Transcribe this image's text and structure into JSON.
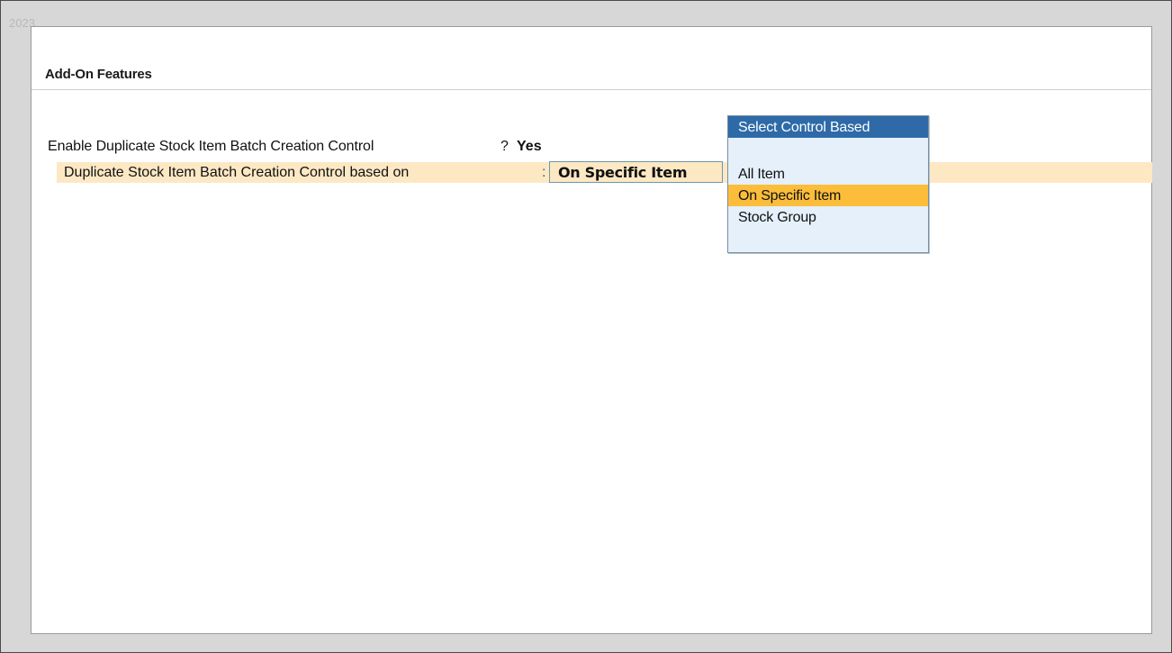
{
  "corner_text": "2023",
  "panel": {
    "title": "Add-On Features"
  },
  "fields": {
    "enable_duplicate": {
      "label": "Enable Duplicate Stock Item Batch Creation Control",
      "separator": "?",
      "value": "Yes"
    },
    "control_based_on": {
      "label": "Duplicate Stock Item Batch Creation Control based on",
      "separator": ":",
      "value": "On Specific Item"
    }
  },
  "popup": {
    "title": "Select Control Based",
    "options": [
      {
        "label": "All Item",
        "selected": false
      },
      {
        "label": "On Specific Item",
        "selected": true
      },
      {
        "label": "Stock Group",
        "selected": false
      }
    ]
  },
  "colors": {
    "popup_header": "#2e6aa8",
    "selected_option": "#fbbd3a",
    "row_highlight": "#fde8c4",
    "popup_background": "#e5f0fb"
  }
}
